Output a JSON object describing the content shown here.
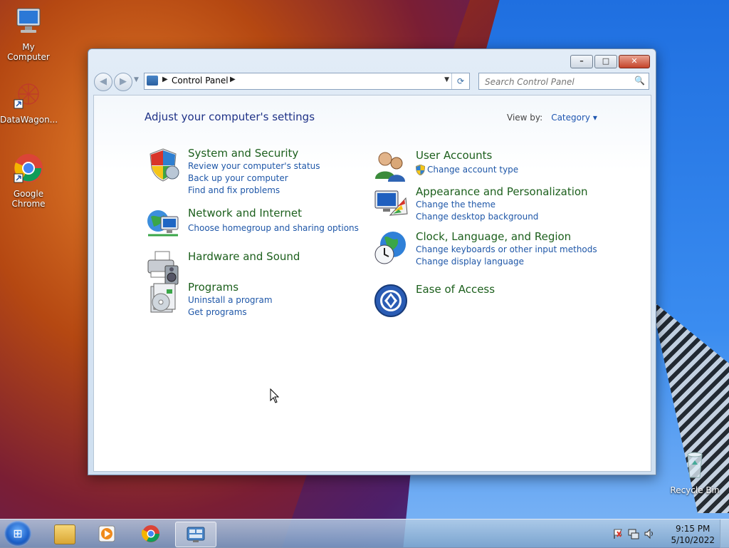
{
  "desktop": {
    "icons": [
      {
        "label": "My Computer"
      },
      {
        "label": "DataWagon..."
      },
      {
        "label": "Google Chrome"
      },
      {
        "label": "Recycle Bin"
      }
    ]
  },
  "window": {
    "controls": {
      "minimize": "–",
      "maximize": "□",
      "close": "✕"
    },
    "nav": {
      "back": "◀",
      "forward": "▶",
      "dropdown": "▼"
    },
    "address": {
      "separator": "▶",
      "crumb": "Control Panel",
      "dropdown": "▼",
      "refresh": "⟳"
    },
    "search": {
      "placeholder": "Search Control Panel",
      "icon": "🔍"
    }
  },
  "control_panel": {
    "heading": "Adjust your computer's settings",
    "view_by_label": "View by:",
    "view_by_value": "Category ▾",
    "categories": [
      {
        "title": "System and Security",
        "icon": "shield-icon",
        "links": [
          "Review your computer's status",
          "Back up your computer",
          "Find and fix problems"
        ]
      },
      {
        "title": "Network and Internet",
        "icon": "network-icon",
        "links": [
          "Choose homegroup and sharing options"
        ]
      },
      {
        "title": "Hardware and Sound",
        "icon": "printer-icon",
        "links": []
      },
      {
        "title": "Programs",
        "icon": "programs-icon",
        "links": [
          "Uninstall a program",
          "Get programs"
        ]
      },
      {
        "title": "User Accounts",
        "icon": "users-icon",
        "links": [
          "Change account type"
        ]
      },
      {
        "title": "Appearance and Personalization",
        "icon": "monitor-palette-icon",
        "links": [
          "Change the theme",
          "Change desktop background"
        ]
      },
      {
        "title": "Clock, Language, and Region",
        "icon": "globe-clock-icon",
        "links": [
          "Change keyboards or other input methods",
          "Change display language"
        ]
      },
      {
        "title": "Ease of Access",
        "icon": "ease-of-access-icon",
        "links": []
      }
    ]
  },
  "taskbar": {
    "start_glyph": "⊞",
    "clock_time": "9:15 PM",
    "clock_date": "5/10/2022",
    "tray_icons": [
      "flag-icon",
      "network-tray-icon",
      "speaker-icon"
    ]
  },
  "colors": {
    "link": "#1f57a8",
    "category_title": "#1c5f1c",
    "heading": "#1e3287"
  }
}
